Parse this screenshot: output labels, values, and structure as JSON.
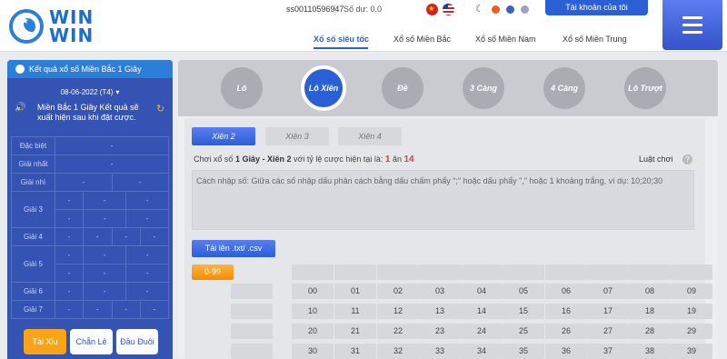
{
  "header": {
    "logo_line1": "WIN",
    "logo_line2": "WIN",
    "account_id": "ss00110596947",
    "balance": "Số dư: 0.0",
    "my_account_label": "Tài khoản của tôi",
    "nav": [
      "Xổ số siêu tốc",
      "Xổ số Miền Bắc",
      "Xổ số Miền Nam",
      "Xổ số Miền Trung"
    ]
  },
  "sidebar": {
    "title": "Kết quả xổ số Miền Bắc 1 Giây",
    "date": "08-06-2022 (T4)",
    "message": "Miền Bắc 1 Giây Kết quả sẽ xuất hiện sau khi đặt cược.",
    "prizes": [
      {
        "label": "Đặc biệt",
        "values": [
          "-"
        ]
      },
      {
        "label": "Giải nhất",
        "values": [
          "-"
        ]
      },
      {
        "label": "Giải nhì",
        "values": [
          "-",
          "-"
        ]
      },
      {
        "label": "Giải 3",
        "values": [
          "-",
          "-",
          "-",
          "-",
          "-",
          "-"
        ]
      },
      {
        "label": "Giải 4",
        "values": [
          "-",
          "-",
          "-",
          "-"
        ]
      },
      {
        "label": "Giải 5",
        "values": [
          "-",
          "-",
          "-",
          "-",
          "-",
          "-"
        ]
      },
      {
        "label": "Giải 6",
        "values": [
          "-",
          "-",
          "-"
        ]
      },
      {
        "label": "Giải 7",
        "values": [
          "-",
          "-",
          "-",
          "-"
        ]
      }
    ],
    "buttons": [
      "Tài Xỉu",
      "Chẵn Lẻ",
      "Đầu Đuôi"
    ]
  },
  "bet_types": [
    "Lô",
    "Lô Xiên",
    "Đề",
    "3 Càng",
    "4 Càng",
    "Lô Trượt"
  ],
  "tabs": [
    "Xiên 2",
    "Xiên 3",
    "Xiên 4"
  ],
  "rate": {
    "prefix": "Chơi xổ số",
    "game": "1 Giây - Xiên 2",
    "middle": "với tỷ lệ cược hiện tại là:",
    "rate_a": "1",
    "rate_sep": "ăn",
    "rate_b": "14"
  },
  "rules_label": "Luật chơi",
  "input_placeholder": "Cách nhập số: Giữa các số nhập dấu phân cách bằng dấu chấm phẩy \";\" hoặc dấu phẩy \",\" hoặc 1 khoảng trắng, ví dụ: 10;20;30",
  "upload_label": "Tải lên .txt/ .csv",
  "range_label": "0-99",
  "numbers": [
    [
      "00",
      "01",
      "02",
      "03",
      "04",
      "05",
      "06",
      "07",
      "08",
      "09"
    ],
    [
      "10",
      "11",
      "12",
      "13",
      "14",
      "15",
      "16",
      "17",
      "18",
      "19"
    ],
    [
      "20",
      "21",
      "22",
      "23",
      "24",
      "25",
      "26",
      "27",
      "28",
      "29"
    ],
    [
      "30",
      "31",
      "32",
      "33",
      "34",
      "35",
      "36",
      "37",
      "38",
      "39"
    ]
  ],
  "colors": {
    "accent": "#2b5fd6",
    "sidebar": "#3553b3",
    "orange": "#f9a418",
    "rate_red": "#e53935"
  }
}
